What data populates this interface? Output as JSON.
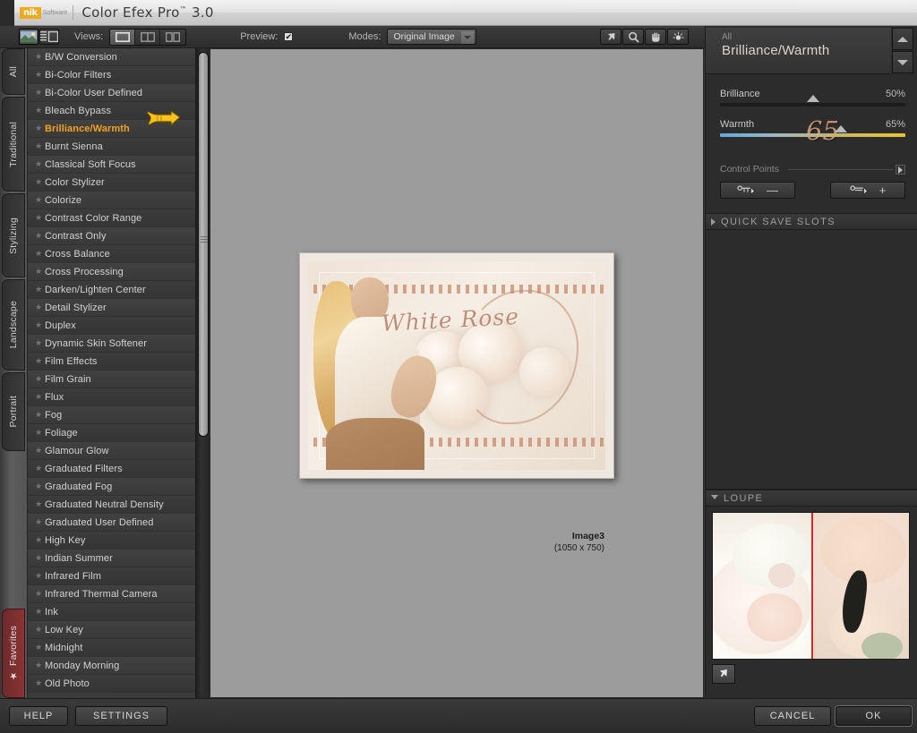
{
  "titlebar": {
    "brand": "nik",
    "brand_sub": "Software",
    "app_title": "Color Efex Pro",
    "tm": "™",
    "version": "3.0"
  },
  "toolbar": {
    "image_view_icon": "image-thumbnail-icon",
    "list_view_icon": "list-view-icon",
    "views_label": "Views:",
    "view_modes": [
      {
        "name": "single-view",
        "icon": "single-pane-icon",
        "selected": true
      },
      {
        "name": "split-view",
        "icon": "split-pane-icon",
        "selected": false
      },
      {
        "name": "side-by-side-view",
        "icon": "side-by-side-pane-icon",
        "selected": false
      }
    ],
    "preview_label": "Preview:",
    "preview_checked": true,
    "preview_check_glyph": "✔",
    "modes_label": "Modes:",
    "modes_value": "Original Image",
    "modes_options": [
      "Original Image"
    ],
    "tools": [
      {
        "name": "select-tool",
        "icon": "arrow-cursor-icon",
        "selected": false
      },
      {
        "name": "zoom-tool",
        "icon": "magnifier-icon",
        "selected": false
      },
      {
        "name": "pan-tool",
        "icon": "hand-icon",
        "selected": false
      },
      {
        "name": "control-point-tool",
        "icon": "brightness-burst-icon",
        "selected": false
      }
    ]
  },
  "category_tabs": [
    {
      "label": "All",
      "active": true
    },
    {
      "label": "Traditional",
      "active": false
    },
    {
      "label": "Stylizing",
      "active": false
    },
    {
      "label": "Landscape",
      "active": false
    },
    {
      "label": "Portrait",
      "active": false
    },
    {
      "label": "Favorites",
      "active": false,
      "favorite": true,
      "star": "★"
    }
  ],
  "filter_list": {
    "star_glyph": "★",
    "items": [
      {
        "label": "B/W Conversion",
        "active": false
      },
      {
        "label": "Bi-Color Filters",
        "active": false
      },
      {
        "label": "Bi-Color User Defined",
        "active": false
      },
      {
        "label": "Bleach Bypass",
        "active": false
      },
      {
        "label": "Brilliance/Warmth",
        "active": true
      },
      {
        "label": "Burnt Sienna",
        "active": false
      },
      {
        "label": "Classical Soft Focus",
        "active": false
      },
      {
        "label": "Color Stylizer",
        "active": false
      },
      {
        "label": "Colorize",
        "active": false
      },
      {
        "label": "Contrast Color Range",
        "active": false
      },
      {
        "label": "Contrast Only",
        "active": false
      },
      {
        "label": "Cross Balance",
        "active": false
      },
      {
        "label": "Cross Processing",
        "active": false
      },
      {
        "label": "Darken/Lighten Center",
        "active": false
      },
      {
        "label": "Detail Stylizer",
        "active": false
      },
      {
        "label": "Duplex",
        "active": false
      },
      {
        "label": "Dynamic Skin Softener",
        "active": false
      },
      {
        "label": "Film Effects",
        "active": false
      },
      {
        "label": "Film Grain",
        "active": false
      },
      {
        "label": "Flux",
        "active": false
      },
      {
        "label": "Fog",
        "active": false
      },
      {
        "label": "Foliage",
        "active": false
      },
      {
        "label": "Glamour Glow",
        "active": false
      },
      {
        "label": "Graduated Filters",
        "active": false
      },
      {
        "label": "Graduated Fog",
        "active": false
      },
      {
        "label": "Graduated Neutral Density",
        "active": false
      },
      {
        "label": "Graduated User Defined",
        "active": false
      },
      {
        "label": "High Key",
        "active": false
      },
      {
        "label": "Indian Summer",
        "active": false
      },
      {
        "label": "Infrared Film",
        "active": false
      },
      {
        "label": "Infrared Thermal Camera",
        "active": false
      },
      {
        "label": "Ink",
        "active": false
      },
      {
        "label": "Low Key",
        "active": false
      },
      {
        "label": "Midnight",
        "active": false
      },
      {
        "label": "Monday Morning",
        "active": false
      },
      {
        "label": "Old Photo",
        "active": false
      }
    ]
  },
  "canvas": {
    "image_title_text": "White Rose",
    "caption_name": "Image3",
    "caption_dimensions": "(1050 x 750)"
  },
  "right_panel": {
    "category": "All",
    "filter_name": "Brilliance/Warmth",
    "nav_prev_icon": "chevron-up-icon",
    "nav_next_icon": "chevron-down-icon",
    "sliders": [
      {
        "name": "Brilliance",
        "value": "50%",
        "percent": 50,
        "gradient": false
      },
      {
        "name": "Warmth",
        "value": "65%",
        "percent": 65,
        "gradient": true,
        "big_value": "65"
      }
    ],
    "control_points": {
      "legend": "Control Points",
      "expand_icon": "expand-right-icon",
      "buttons": [
        {
          "name": "remove-control-point",
          "icon": "control-point-icon",
          "sign": "—"
        },
        {
          "name": "add-control-point",
          "icon": "control-point-icon",
          "sign": "+"
        }
      ]
    },
    "quick_save_slots": {
      "label": "QUICK SAVE SLOTS",
      "expanded": false
    },
    "loupe": {
      "label": "LOUPE",
      "expanded": true,
      "pin_icon": "pin-cursor-icon"
    }
  },
  "bottom_bar": {
    "help_label": "HELP",
    "settings_label": "SETTINGS",
    "cancel_label": "CANCEL",
    "ok_label": "OK"
  },
  "colors": {
    "accent": "#f2a21e",
    "warm_value": "#c28f72",
    "loupe_divider": "#d22b2b",
    "favorites_tab": "#8a3333"
  }
}
